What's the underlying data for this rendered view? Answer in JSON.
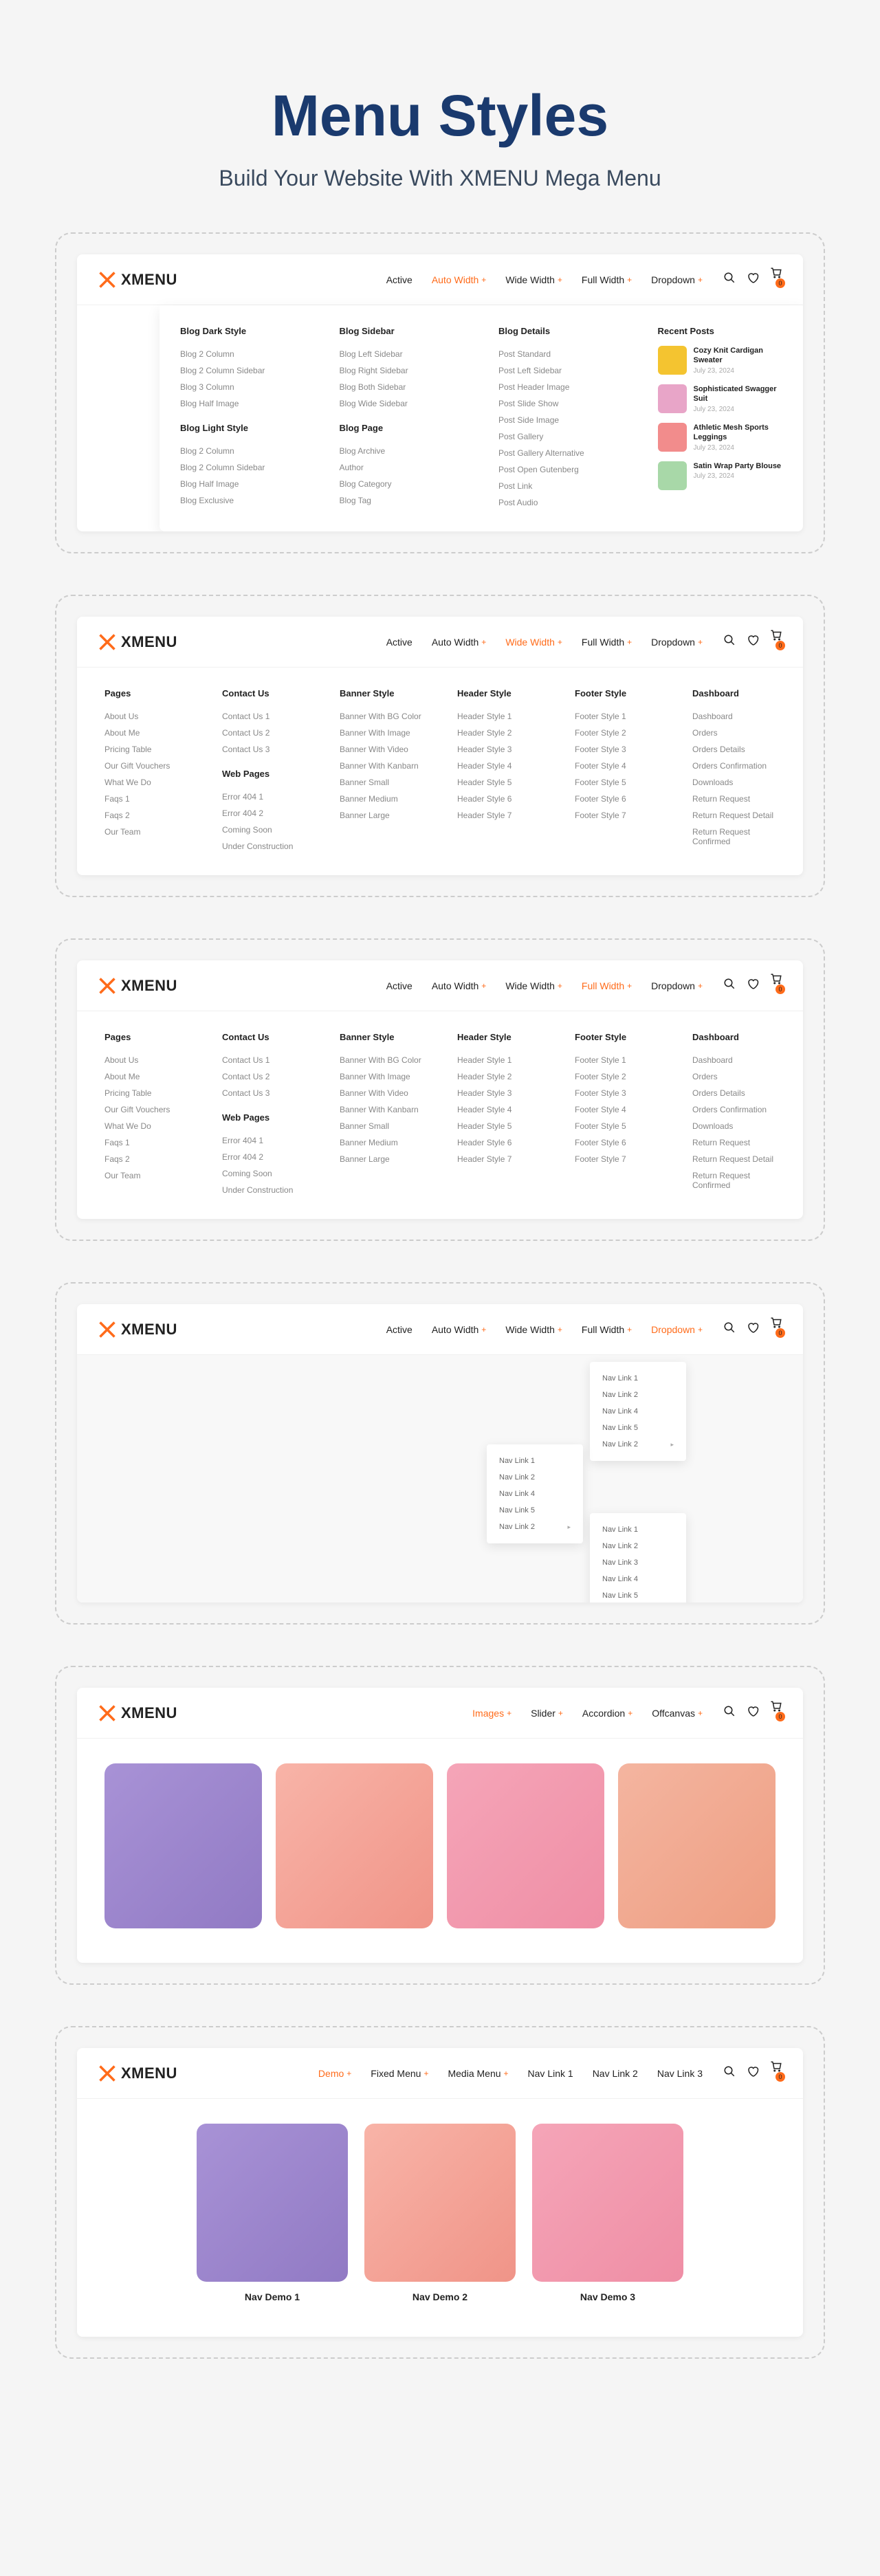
{
  "header": {
    "title": "Menu Styles",
    "subtitle": "Build Your Website With XMENU Mega Menu"
  },
  "logo": "XMENU",
  "nav1": [
    "Active",
    "Auto Width",
    "Wide Width",
    "Full Width",
    "Dropdown"
  ],
  "nav5": [
    "Images",
    "Slider",
    "Accordion",
    "Offcanvas"
  ],
  "nav6": [
    "Demo",
    "Fixed Menu",
    "Media Menu",
    "Nav Link 1",
    "Nav Link 2",
    "Nav Link 3"
  ],
  "cart_count": "0",
  "card1": {
    "cols": [
      {
        "heading": "Blog Dark Style",
        "items": [
          "Blog 2 Column",
          "Blog 2 Column Sidebar",
          "Blog 3 Column",
          "Blog Half Image"
        ],
        "heading2": "Blog Light Style",
        "items2": [
          "Blog 2 Column",
          "Blog 2 Column Sidebar",
          "Blog Half Image",
          "Blog Exclusive"
        ]
      },
      {
        "heading": "Blog Sidebar",
        "items": [
          "Blog Left Sidebar",
          "Blog Right Sidebar",
          "Blog Both Sidebar",
          "Blog Wide Sidebar"
        ],
        "heading2": "Blog Page",
        "items2": [
          "Blog Archive",
          "Author",
          "Blog Category",
          "Blog Tag"
        ]
      },
      {
        "heading": "Blog Details",
        "items": [
          "Post Standard",
          "Post Left Sidebar",
          "Post Header Image",
          "Post Slide Show",
          "Post Side Image",
          "Post Gallery",
          "Post Gallery Alternative",
          "Post Open Gutenberg",
          "Post Link",
          "Post Audio"
        ]
      }
    ],
    "recent_heading": "Recent Posts",
    "posts": [
      {
        "title": "Cozy Knit Cardigan Sweater",
        "date": "July 23, 2024"
      },
      {
        "title": "Sophisticated Swagger Suit",
        "date": "July 23, 2024"
      },
      {
        "title": "Athletic Mesh Sports Leggings",
        "date": "July 23, 2024"
      },
      {
        "title": "Satin Wrap Party Blouse",
        "date": "July 23, 2024"
      }
    ]
  },
  "card2": {
    "cols": [
      {
        "heading": "Pages",
        "items": [
          "About Us",
          "About Me",
          "Pricing Table",
          "Our Gift Vouchers",
          "What We Do",
          "Faqs 1",
          "Faqs 2",
          "Our Team"
        ]
      },
      {
        "heading": "Contact Us",
        "items": [
          "Contact Us 1",
          "Contact Us 2",
          "Contact Us 3"
        ],
        "heading2": "Web Pages",
        "items2": [
          "Error 404 1",
          "Error 404 2",
          "Coming Soon",
          "Under Construction"
        ]
      },
      {
        "heading": "Banner Style",
        "items": [
          "Banner With BG Color",
          "Banner With Image",
          "Banner With Video",
          "Banner With Kanbarn",
          "Banner Small",
          "Banner Medium",
          "Banner Large"
        ]
      },
      {
        "heading": "Header Style",
        "items": [
          "Header Style 1",
          "Header Style 2",
          "Header Style 3",
          "Header Style 4",
          "Header Style 5",
          "Header Style 6",
          "Header Style 7"
        ]
      },
      {
        "heading": "Footer Style",
        "items": [
          "Footer Style 1",
          "Footer Style 2",
          "Footer Style 3",
          "Footer Style 4",
          "Footer Style 5",
          "Footer Style 6",
          "Footer Style 7"
        ]
      },
      {
        "heading": "Dashboard",
        "items": [
          "Dashboard",
          "Orders",
          "Orders Details",
          "Orders Confirmation",
          "Downloads",
          "Return Request",
          "Return Request Detail",
          "Return Request Confirmed"
        ]
      }
    ]
  },
  "card4": {
    "dd1": [
      "Nav Link 1",
      "Nav Link 2",
      "Nav Link 4",
      "Nav Link 5",
      "Nav Link 2"
    ],
    "dd2": [
      "Nav Link 1",
      "Nav Link 2",
      "Nav Link 4",
      "Nav Link 5",
      "Nav Link 2"
    ],
    "dd3": [
      "Nav Link 1",
      "Nav Link 2",
      "Nav Link 3",
      "Nav Link 4",
      "Nav Link 5"
    ]
  },
  "card6": {
    "labels": [
      "Nav Demo 1",
      "Nav Demo 2",
      "Nav Demo 3"
    ]
  }
}
